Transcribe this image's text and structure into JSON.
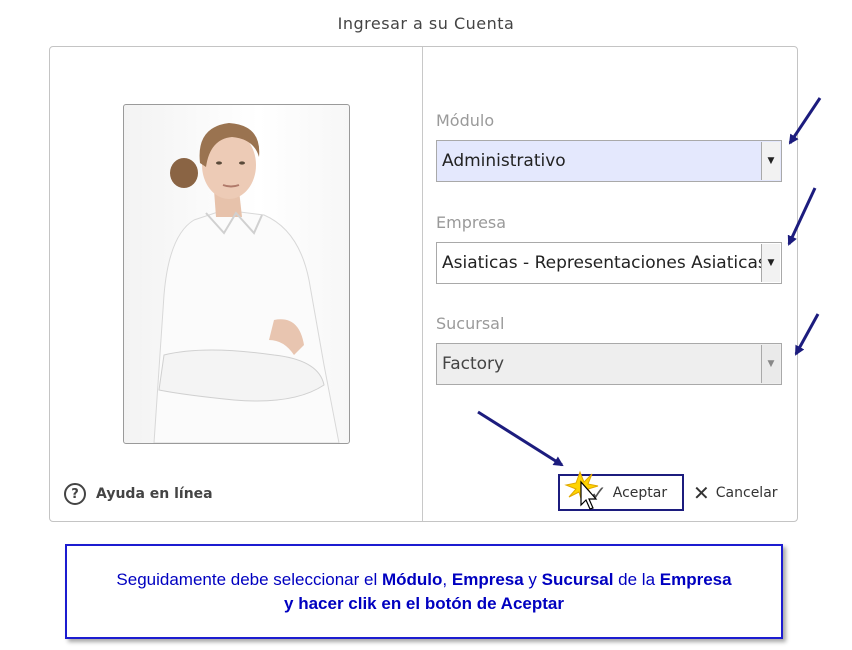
{
  "dialog": {
    "title": "Ingresar a su Cuenta",
    "help_label": "Ayuda en línea"
  },
  "form": {
    "modulo": {
      "label": "Módulo",
      "value": "Administrativo"
    },
    "empresa": {
      "label": "Empresa",
      "value": "Asiaticas - Representaciones Asiaticas"
    },
    "sucursal": {
      "label": "Sucursal",
      "value": "Factory"
    }
  },
  "buttons": {
    "accept_label": "Aceptar",
    "cancel_label": "Cancelar"
  },
  "note": {
    "part1": "Seguidamente debe seleccionar el ",
    "modulo": "Módulo",
    "sep1": ", ",
    "empresa": "Empresa",
    "sep2": " y ",
    "sucursal": "Sucursal",
    "part2": " de la ",
    "empresa2": "Empresa",
    "line2": "y hacer clik en el botón de Aceptar"
  },
  "colors": {
    "annotation_arrow": "#1c1c7e",
    "note_text": "#0000c0",
    "selected_field_bg": "#e4e8fd"
  },
  "icons": {
    "help": "question-circle-icon",
    "accept": "check-icon",
    "cancel": "x-icon",
    "cursor": "mouse-pointer-icon",
    "arrows": "annotation-arrow-icon"
  }
}
